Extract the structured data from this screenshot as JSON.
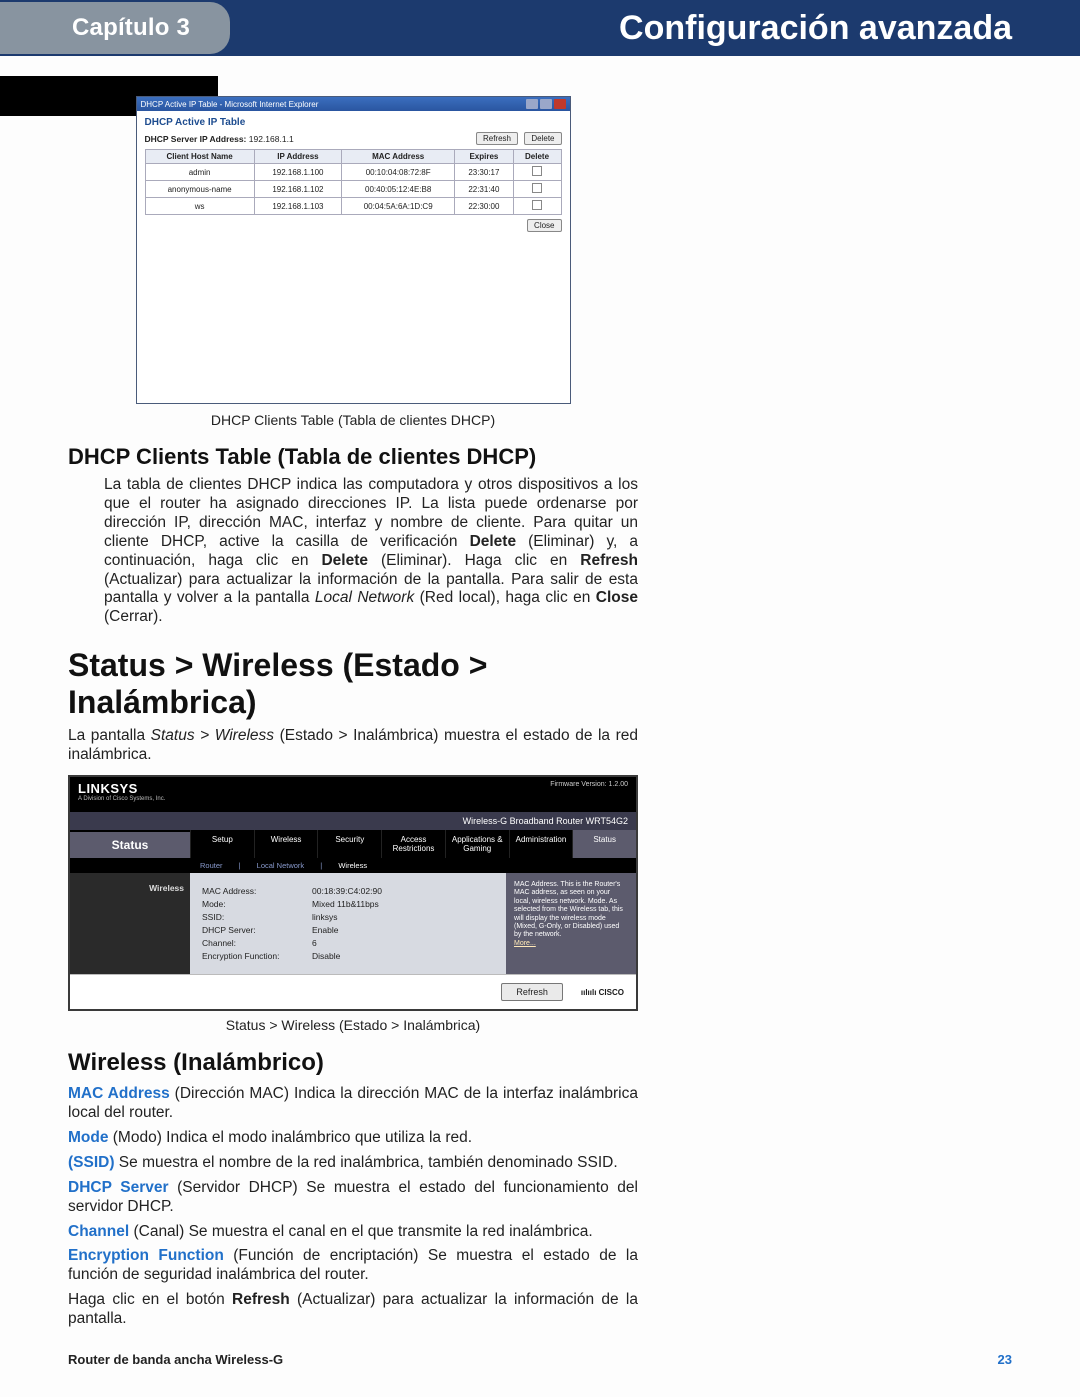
{
  "header": {
    "chapter": "Capítulo 3",
    "pageTitle": "Configuración avanzada"
  },
  "dhcpWindow": {
    "titlebar": "DHCP Active IP Table - Microsoft Internet Explorer",
    "heading": "DHCP Active IP Table",
    "serverLabel": "DHCP Server IP Address:",
    "serverValue": "192.168.1.1",
    "buttons": {
      "refresh": "Refresh",
      "delete": "Delete",
      "close": "Close"
    },
    "columns": [
      "Client Host Name",
      "IP Address",
      "MAC Address",
      "Expires",
      "Delete"
    ],
    "rows": [
      {
        "host": "admin",
        "ip": "192.168.1.100",
        "mac": "00:10:04:08:72:8F",
        "exp": "23:30:17"
      },
      {
        "host": "anonymous-name",
        "ip": "192.168.1.102",
        "mac": "00:40:05:12:4E:B8",
        "exp": "22:31:40"
      },
      {
        "host": "ws",
        "ip": "192.168.1.103",
        "mac": "00:04:5A:6A:1D:C9",
        "exp": "22:30:00"
      }
    ]
  },
  "figCaptions": {
    "dhcp": "DHCP Clients Table (Tabla de clientes DHCP)",
    "status": "Status > Wireless (Estado > Inalámbrica)"
  },
  "section1": {
    "heading": "DHCP Clients Table (Tabla de clientes DHCP)",
    "p_a": "La tabla de clientes DHCP indica las computadora y otros dispositivos a los que el router ha asignado direcciones IP. La lista puede ordenarse por dirección IP, dirección MAC, interfaz y nombre de cliente. Para quitar un cliente DHCP, active la casilla de verificación ",
    "p_b": " (Eliminar) y, a continuación, haga clic en ",
    "p_c": " (Eliminar). Haga clic en ",
    "p_d": " (Actualizar) para actualizar la información de la pantalla. Para salir de esta pantalla y volver a la pantalla ",
    "p_e": " (Red local), haga clic en ",
    "p_f": " (Cerrar).",
    "bold": {
      "delete1": "Delete",
      "delete2": "Delete",
      "refresh": "Refresh",
      "close": "Close"
    },
    "ital": {
      "localNetwork": "Local Network"
    }
  },
  "section2": {
    "heading": "Status > Wireless (Estado > Inalámbrica)",
    "p_a": "La pantalla ",
    "p_b": " (Estado > Inalámbrica) muestra el estado de la red inalámbrica.",
    "ital": "Status > Wireless"
  },
  "statusWindow": {
    "logo": "LINKSYS",
    "sublogo": "A Division of Cisco Systems, Inc.",
    "fw": "Firmware Version: 1.2.00",
    "productBar": "Wireless-G Broadband Router    WRT54G2",
    "statusWord": "Status",
    "tabs": [
      "Setup",
      "Wireless",
      "Security",
      "Access Restrictions",
      "Applications & Gaming",
      "Administration",
      "Status"
    ],
    "subtabs": {
      "router": "Router",
      "localnet": "Local Network",
      "wireless": "Wireless"
    },
    "sidebar": "Wireless",
    "fields": {
      "mac": {
        "lbl": "MAC Address:",
        "val": "00:18:39:C4:02:90"
      },
      "mode": {
        "lbl": "Mode:",
        "val": "Mixed 11b&11bps"
      },
      "ssid": {
        "lbl": "SSID:",
        "val": "linksys"
      },
      "dhcp": {
        "lbl": "DHCP Server:",
        "val": "Enable"
      },
      "chan": {
        "lbl": "Channel:",
        "val": "6"
      },
      "enc": {
        "lbl": "Encryption Function:",
        "val": "Disable"
      }
    },
    "help": "MAC Address. This is the Router's MAC address, as seen on your local, wireless network.\nMode. As selected from the Wireless tab, this will display the wireless mode (Mixed, G-Only, or Disabled) used by the network.",
    "more": "More...",
    "refresh": "Refresh",
    "cisco": "CISCO"
  },
  "section3": {
    "heading": "Wireless (Inalámbrico)",
    "items": {
      "mac": {
        "kw": "MAC Address",
        "txt": "  (Dirección MAC) Indica la dirección MAC de la interfaz inalámbrica local del router."
      },
      "mode": {
        "kw": "Mode",
        "txt": "  (Modo) Indica el modo inalámbrico que utiliza la red."
      },
      "ssid": {
        "kw": "(SSID)",
        "txt": "  Se muestra el nombre de la red inalámbrica, también denominado SSID."
      },
      "dhcp": {
        "kw": "DHCP Server",
        "txt": "  (Servidor DHCP) Se muestra el estado del funcionamiento del servidor DHCP."
      },
      "chan": {
        "kw": "Channel",
        "txt": "  (Canal) Se muestra el canal en el que transmite la red inalámbrica."
      },
      "enc": {
        "kw": "Encryption Function",
        "txt": "  (Función de encriptación) Se muestra el estado de la función de seguridad inalámbrica del router."
      }
    },
    "closing_a": "Haga clic en el botón ",
    "closing_b": " (Actualizar) para actualizar la información de la pantalla.",
    "bold": {
      "refresh": "Refresh"
    }
  },
  "footer": {
    "product": "Router de banda ancha Wireless-G",
    "page": "23"
  }
}
